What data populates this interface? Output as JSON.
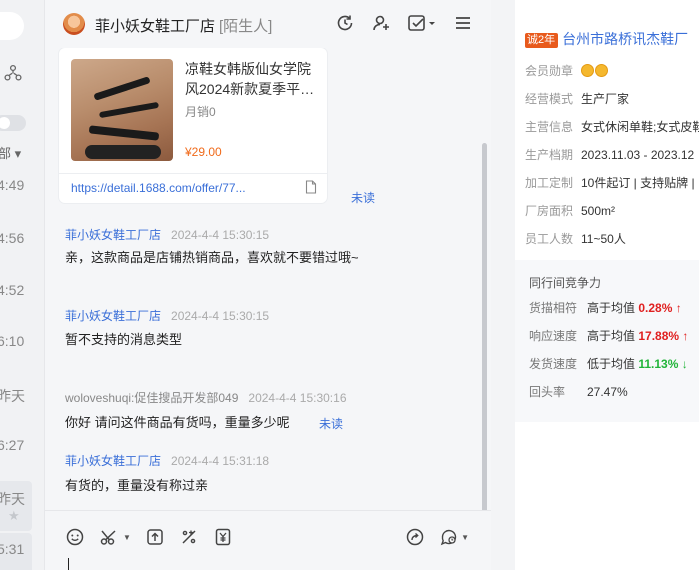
{
  "chat": {
    "title": "菲小妖女鞋工厂店",
    "tag": "[陌生人]"
  },
  "left_list": {
    "filter_label": "部 ▾",
    "times": [
      "4:49",
      "4:56",
      "4:52",
      "6:10",
      "昨天",
      "6:27",
      "昨天",
      "5:31"
    ]
  },
  "product": {
    "title": "凉鞋女韩版仙女学院风2024新款夏季平…",
    "sales": "月销0",
    "price": "¥29.00",
    "link": "https://detail.1688.com/offer/77...",
    "unread": "未读"
  },
  "messages": [
    {
      "sender": "菲小妖女鞋工厂店",
      "time": "2024-4-4 15:30:15",
      "text": "亲，这款商品是店铺热销商品，喜欢就不要错过哦~"
    },
    {
      "sender": "菲小妖女鞋工厂店",
      "time": "2024-4-4 15:30:15",
      "text": "暂不支持的消息类型"
    },
    {
      "sender": "woloveshuqi:促佳搜品开发部049",
      "time": "2024-4-4 15:30:16",
      "text": "你好 请问这件商品有货吗，重量多少呢",
      "unread": "未读"
    },
    {
      "sender": "菲小妖女鞋工厂店",
      "time": "2024-4-4 15:31:18",
      "text": "有货的，重量没有称过亲"
    }
  ],
  "seller": {
    "year_badge_icon": "诚",
    "year_badge": "2年",
    "company": "台州市路桥讯杰鞋厂",
    "rows": [
      {
        "k": "会员勋章",
        "v": ""
      },
      {
        "k": "经营模式",
        "v": "生产厂家"
      },
      {
        "k": "主营信息",
        "v": "女式休闲单鞋;女式皮鞋"
      },
      {
        "k": "生产档期",
        "v": "2023.11.03 - 2023.12"
      },
      {
        "k": "加工定制",
        "v": "10件起订 | 支持贴牌 |"
      },
      {
        "k": "厂房面积",
        "v": "500m²"
      },
      {
        "k": "员工人数",
        "v": "11~50人"
      }
    ],
    "compete_title": "同行间竞争力",
    "compete": [
      {
        "k": "货描相符",
        "level": "高于均值",
        "pct": "0.28%",
        "arrow": "↑"
      },
      {
        "k": "响应速度",
        "level": "高于均值",
        "pct": "17.88%",
        "arrow": "↑"
      },
      {
        "k": "发货速度",
        "level": "低于均值",
        "pct": "11.13%",
        "arrow": "↓"
      },
      {
        "k": "回头率",
        "level": "27.47%",
        "pct": "",
        "arrow": ""
      }
    ]
  }
}
